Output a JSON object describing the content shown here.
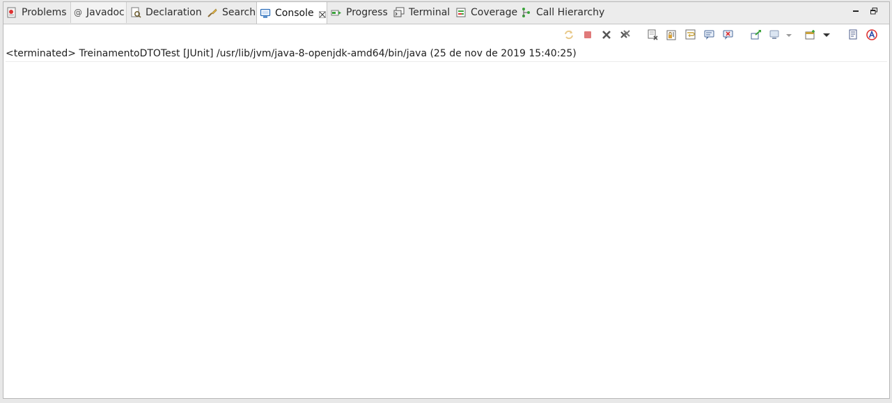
{
  "tabs": [
    {
      "label": "Problems",
      "icon": "problems-icon"
    },
    {
      "label": "Javadoc",
      "icon": "javadoc-icon"
    },
    {
      "label": "Declaration",
      "icon": "declaration-icon"
    },
    {
      "label": "Search",
      "icon": "search-icon"
    },
    {
      "label": "Console",
      "icon": "console-icon",
      "active": true
    },
    {
      "label": "Progress",
      "icon": "progress-icon"
    },
    {
      "label": "Terminal",
      "icon": "terminal-icon"
    },
    {
      "label": "Coverage",
      "icon": "coverage-icon"
    },
    {
      "label": "Call Hierarchy",
      "icon": "call-hierarchy-icon"
    }
  ],
  "javadoc_glyph": "@",
  "console": {
    "process_line": "<terminated> TreinamentoDTOTest [JUnit] /usr/lib/jvm/java-8-openjdk-amd64/bin/java (25 de nov de 2019 15:40:25)",
    "output": ""
  },
  "colors": {
    "accent": "#2a6ebb",
    "stop_disabled": "#e07a7a",
    "remove": "#555555"
  }
}
